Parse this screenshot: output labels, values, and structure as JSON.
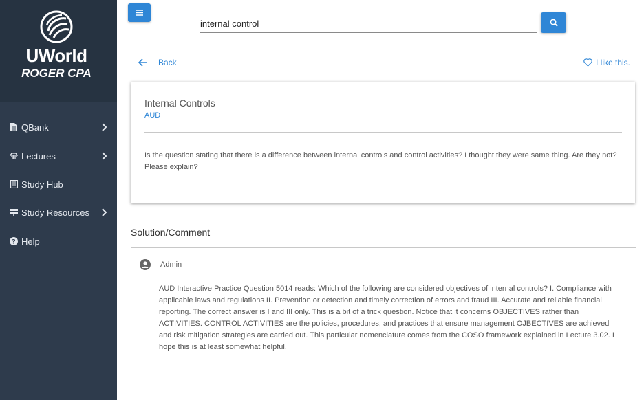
{
  "brand": {
    "name": "UWorld",
    "sub": "ROGER CPA",
    "logo_icon": "globe-icon"
  },
  "sidebar": {
    "items": [
      {
        "label": "QBank",
        "icon": "file-icon",
        "has_chevron": true
      },
      {
        "label": "Lectures",
        "icon": "lecture-icon",
        "has_chevron": true
      },
      {
        "label": "Study Hub",
        "icon": "book-icon",
        "has_chevron": false
      },
      {
        "label": "Study Resources",
        "icon": "resources-icon",
        "has_chevron": true
      },
      {
        "label": "Help",
        "icon": "help-icon",
        "has_chevron": false
      }
    ]
  },
  "search": {
    "value": "internal control"
  },
  "nav": {
    "back_label": "Back",
    "like_label": "I like this."
  },
  "question": {
    "title": "Internal Controls",
    "tag": "AUD",
    "body": "Is the question stating that there is a difference between internal controls and control activities? I thought they were same thing. Are they not? Please explain?"
  },
  "solution": {
    "heading": "Solution/Comment",
    "author": "Admin",
    "body": "AUD Interactive Practice Question 5014 reads: Which of the following are considered objectives of internal controls? I. Compliance with applicable laws and regulations II. Prevention or detection and timely correction of errors and fraud III. Accurate and reliable financial reporting. The correct answer is I and III only. This is a bit of a trick question. Notice that it concerns OBJECTIVES rather than ACTIVITIES. CONTROL ACTIVITIES are the policies, procedures, and practices that ensure management OJBECTIVES are achieved and risk mitigation strategies are carried out. This particular nomenclature comes from the COSO framework explained in Lecture 3.02. I hope this is at least somewhat helpful."
  },
  "colors": {
    "sidebar": "#2e3b4c",
    "brand_bg": "#263341",
    "accent": "#2f86d6"
  }
}
